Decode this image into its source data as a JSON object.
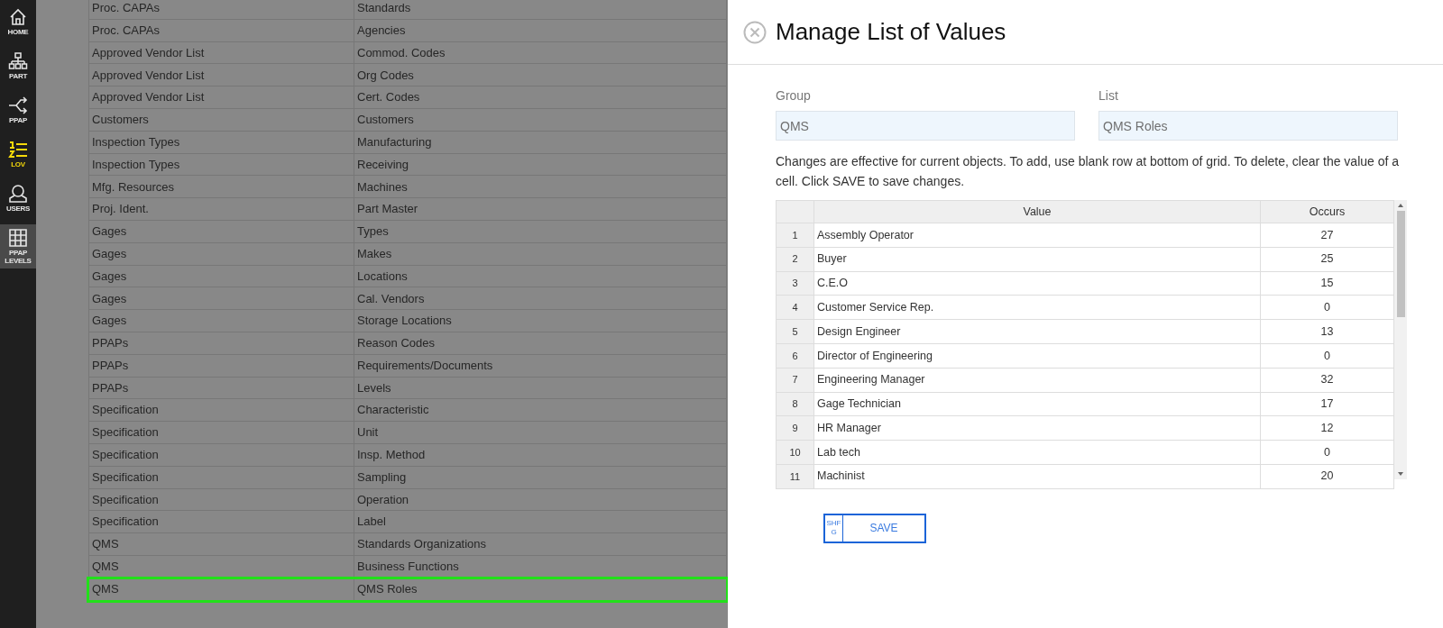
{
  "nav": [
    {
      "kind": "home",
      "label": "HOME",
      "selected": false,
      "hovered": false
    },
    {
      "kind": "part",
      "label": "PART",
      "selected": false,
      "hovered": false
    },
    {
      "kind": "ppap",
      "label": "PPAP",
      "selected": false,
      "hovered": false
    },
    {
      "kind": "lov",
      "label": "LOV",
      "selected": true,
      "hovered": false
    },
    {
      "kind": "users",
      "label": "USERS",
      "selected": false,
      "hovered": false
    },
    {
      "kind": "grid",
      "label": "PPAP LEVELS",
      "selected": false,
      "hovered": true
    }
  ],
  "lists_table": {
    "rows": [
      {
        "group": "Proc. CAPAs",
        "list": "Standards",
        "selected": false
      },
      {
        "group": "Proc. CAPAs",
        "list": "Agencies",
        "selected": false
      },
      {
        "group": "Approved Vendor List",
        "list": "Commod. Codes",
        "selected": false
      },
      {
        "group": "Approved Vendor List",
        "list": "Org Codes",
        "selected": false
      },
      {
        "group": "Approved Vendor List",
        "list": "Cert. Codes",
        "selected": false
      },
      {
        "group": "Customers",
        "list": "Customers",
        "selected": false
      },
      {
        "group": "Inspection Types",
        "list": "Manufacturing",
        "selected": false
      },
      {
        "group": "Inspection Types",
        "list": "Receiving",
        "selected": false
      },
      {
        "group": "Mfg. Resources",
        "list": "Machines",
        "selected": false
      },
      {
        "group": "Proj. Ident.",
        "list": "Part Master",
        "selected": false
      },
      {
        "group": "Gages",
        "list": "Types",
        "selected": false
      },
      {
        "group": "Gages",
        "list": "Makes",
        "selected": false
      },
      {
        "group": "Gages",
        "list": "Locations",
        "selected": false
      },
      {
        "group": "Gages",
        "list": "Cal. Vendors",
        "selected": false
      },
      {
        "group": "Gages",
        "list": "Storage Locations",
        "selected": false
      },
      {
        "group": "PPAPs",
        "list": "Reason Codes",
        "selected": false
      },
      {
        "group": "PPAPs",
        "list": "Requirements/Documents",
        "selected": false
      },
      {
        "group": "PPAPs",
        "list": "Levels",
        "selected": false
      },
      {
        "group": "Specification",
        "list": "Characteristic",
        "selected": false
      },
      {
        "group": "Specification",
        "list": "Unit",
        "selected": false
      },
      {
        "group": "Specification",
        "list": "Insp. Method",
        "selected": false
      },
      {
        "group": "Specification",
        "list": "Sampling",
        "selected": false
      },
      {
        "group": "Specification",
        "list": "Operation",
        "selected": false
      },
      {
        "group": "Specification",
        "list": "Label",
        "selected": false
      },
      {
        "group": "QMS",
        "list": "Standards Organizations",
        "selected": false
      },
      {
        "group": "QMS",
        "list": "Business Functions",
        "selected": false
      },
      {
        "group": "QMS",
        "list": "QMS Roles",
        "selected": true
      }
    ]
  },
  "panel": {
    "title": "Manage List of Values",
    "group_field": {
      "label": "Group",
      "value": "QMS"
    },
    "list_field": {
      "label": "List",
      "value": "QMS Roles"
    },
    "instructions": "Changes are effective for current objects. To add, use blank row at bottom of grid. To delete, clear the value of a cell. Click SAVE to save changes.",
    "grid": {
      "columns": [
        "Value",
        "Occurs"
      ],
      "rows": [
        {
          "num": "1",
          "value": "Assembly Operator",
          "occurs": "27"
        },
        {
          "num": "2",
          "value": "Buyer",
          "occurs": "25"
        },
        {
          "num": "3",
          "value": "C.E.O",
          "occurs": "15"
        },
        {
          "num": "4",
          "value": "Customer Service Rep.",
          "occurs": "0"
        },
        {
          "num": "5",
          "value": "Design Engineer",
          "occurs": "13"
        },
        {
          "num": "6",
          "value": "Director of Engineering",
          "occurs": "0"
        },
        {
          "num": "7",
          "value": "Engineering Manager",
          "occurs": "32"
        },
        {
          "num": "8",
          "value": "Gage Technician",
          "occurs": "17"
        },
        {
          "num": "9",
          "value": "HR Manager",
          "occurs": "12"
        },
        {
          "num": "10",
          "value": "Lab tech",
          "occurs": "0"
        },
        {
          "num": "11",
          "value": "Machinist",
          "occurs": "20"
        }
      ]
    },
    "save_button": {
      "shortcut": "SHFG",
      "label": "SAVE"
    }
  }
}
